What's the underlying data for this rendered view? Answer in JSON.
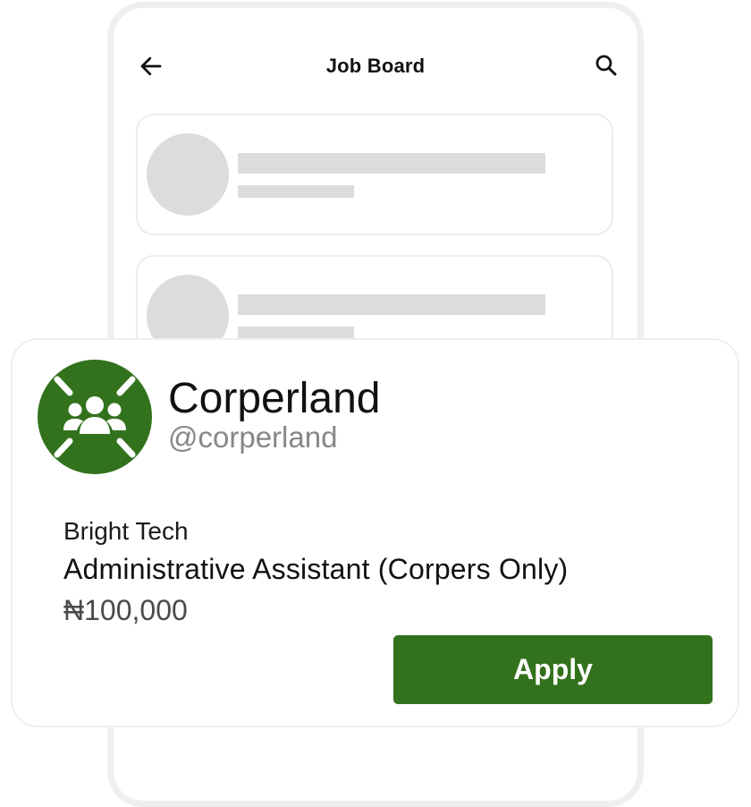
{
  "screen": {
    "title": "Job Board",
    "back_icon": "arrow-left-icon",
    "search_icon": "search-icon"
  },
  "skeleton_cards": [
    {
      "state": "loading"
    },
    {
      "state": "loading"
    }
  ],
  "job_card": {
    "company": {
      "name": "Corperland",
      "handle": "@corperland",
      "logo_icon": "group-people-icon",
      "logo_color": "#33721d"
    },
    "employer": "Bright Tech",
    "title": "Administrative Assistant (Corpers Only)",
    "salary": "₦100,000",
    "apply_label": "Apply",
    "accent": "#33721d"
  }
}
